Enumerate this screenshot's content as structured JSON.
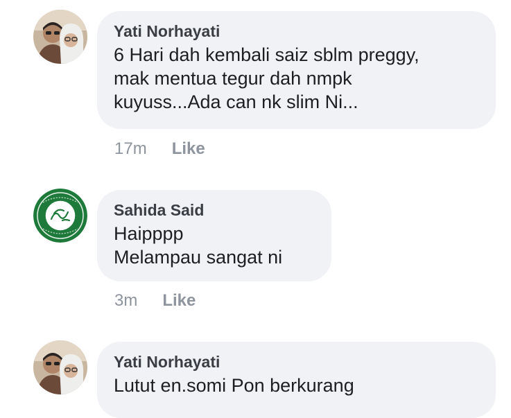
{
  "comments": [
    {
      "author": "Yati Norhayati",
      "text": "6 Hari dah kembali saiz sblm preggy,\nmak mentua tegur dah nmpk\nkuyuss...Ada can nk slim Ni...",
      "time": "17m",
      "like_label": "Like",
      "avatar": "couple-photo-avatar"
    },
    {
      "author": "Sahida Said",
      "text": "Haipppp\nMelampau sangat ni",
      "time": "3m",
      "like_label": "Like",
      "avatar": "green-calligraphy-emblem-avatar"
    },
    {
      "author": "Yati Norhayati",
      "text": "Lutut en.somi Pon berkurang",
      "avatar": "couple-photo-avatar"
    }
  ],
  "colors": {
    "bubble": "#f1f2f6",
    "author": "#3b3d44",
    "text": "#1c1e21",
    "meta": "#8d949e",
    "emblem_green": "#1e7a3a"
  }
}
